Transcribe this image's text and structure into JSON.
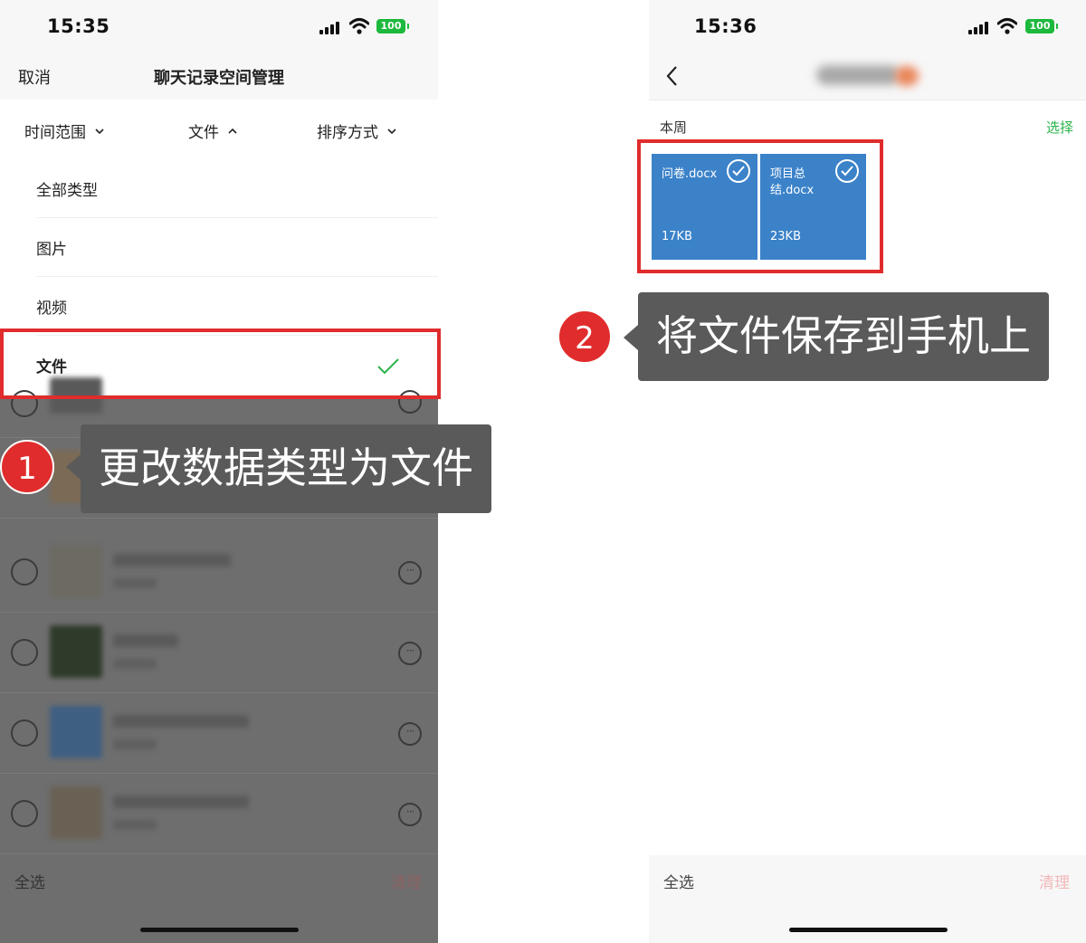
{
  "left_screen": {
    "status": {
      "time": "15:35",
      "battery": "100"
    },
    "nav": {
      "cancel": "取消",
      "title": "聊天记录空间管理"
    },
    "filters": [
      {
        "label": "时间范围"
      },
      {
        "label": "文件"
      },
      {
        "label": "排序方式"
      }
    ],
    "type_menu": [
      {
        "label": "全部类型"
      },
      {
        "label": "图片"
      },
      {
        "label": "视频"
      },
      {
        "label": "文件"
      }
    ],
    "bottom": {
      "select_all": "全选",
      "clear": "清理"
    }
  },
  "right_screen": {
    "status": {
      "time": "15:36",
      "battery": "100"
    },
    "section_label": "本周",
    "select_link": "选择",
    "files": [
      {
        "name": "问卷.docx",
        "size": "17KB"
      },
      {
        "name": "项目总结.docx",
        "size": "23KB"
      }
    ],
    "bottom": {
      "select_all": "全选",
      "clear": "清理"
    }
  },
  "annotations": [
    {
      "number": "1",
      "text": "更改数据类型为文件"
    },
    {
      "number": "2",
      "text": "将文件保存到手机上"
    }
  ],
  "colors": {
    "accent_green": "#2bb34a",
    "highlight_red": "#e02c2c",
    "file_blue": "#3b82c9",
    "callout_bg": "#5a5a5a"
  }
}
